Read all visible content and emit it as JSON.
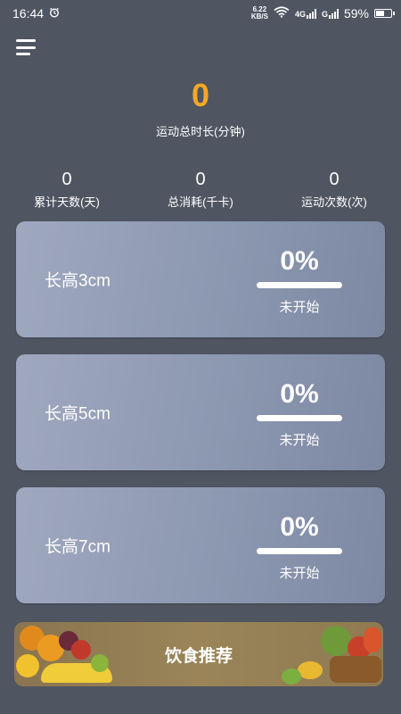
{
  "status_bar": {
    "time": "16:44",
    "net_speed_value": "6.22",
    "net_speed_unit": "KB/S",
    "signal1_label": "4G",
    "signal2_label": "G",
    "battery": "59%",
    "battery_level": 0.59
  },
  "summary": {
    "total_minutes": "0",
    "total_minutes_label": "运动总时长(分钟)",
    "stats": [
      {
        "value": "0",
        "label": "累计天数(天)"
      },
      {
        "value": "0",
        "label": "总消耗(千卡)"
      },
      {
        "value": "0",
        "label": "运动次数(次)"
      }
    ]
  },
  "plans": [
    {
      "title": "长高3cm",
      "percent": "0%",
      "progress": 0,
      "status": "未开始"
    },
    {
      "title": "长高5cm",
      "percent": "0%",
      "progress": 0,
      "status": "未开始"
    },
    {
      "title": "长高7cm",
      "percent": "0%",
      "progress": 0,
      "status": "未开始"
    }
  ],
  "diet_banner": {
    "label": "饮食推荐"
  },
  "colors": {
    "background": "#4f5561",
    "accent": "#f4a825",
    "card": "#8e99b2"
  },
  "icons": {
    "menu": "hamburger-menu-icon",
    "alarm": "alarm-clock-icon",
    "wifi": "wifi-icon",
    "signal": "cell-signal-icon",
    "battery": "battery-icon"
  }
}
